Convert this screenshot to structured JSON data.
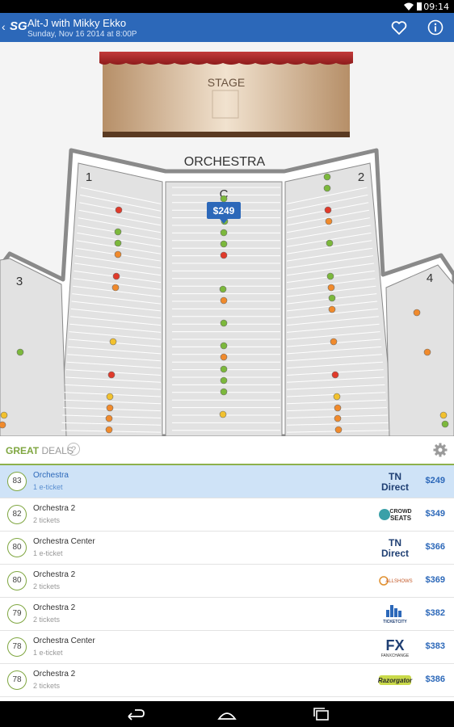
{
  "status_bar": {
    "time": "09:14"
  },
  "header": {
    "logo_text": "SG",
    "title": "Alt-J with Mikky Ekko",
    "subtitle": "Sunday, Nov 16 2014 at 8:00P"
  },
  "seat_map": {
    "stage_label": "STAGE",
    "orchestra_label": "ORCHESTRA",
    "section_numbers": [
      "1",
      "2",
      "3",
      "4"
    ],
    "center_section_label": "C",
    "price_tooltip": "$249"
  },
  "deals": {
    "title_great": "GREAT",
    "title_deals": " DEALS",
    "help_icon": "?",
    "rows": [
      {
        "score": "83",
        "section": "Orchestra",
        "tickets": "1 e-ticket",
        "vendor": "TN Direct",
        "vendor_line1": "TN",
        "vendor_line2": "Direct",
        "price": "$249",
        "selected": true
      },
      {
        "score": "82",
        "section": "Orchestra 2",
        "tickets": "2 tickets",
        "vendor": "CrowdSeats",
        "vendor_line1": "CROWD",
        "vendor_line2": "SEATS",
        "price": "$349"
      },
      {
        "score": "80",
        "section": "Orchestra Center",
        "tickets": "1 e-ticket",
        "vendor": "TN Direct",
        "vendor_line1": "TN",
        "vendor_line2": "Direct",
        "price": "$366"
      },
      {
        "score": "80",
        "section": "Orchestra 2",
        "tickets": "2 tickets",
        "vendor": "AllShows",
        "vendor_line1": "ALLSHOWS",
        "vendor_line2": "",
        "price": "$369"
      },
      {
        "score": "79",
        "section": "Orchestra 2",
        "tickets": "2 tickets",
        "vendor": "TicketCity",
        "vendor_line1": "TICKETCITY",
        "vendor_line2": "",
        "price": "$382"
      },
      {
        "score": "78",
        "section": "Orchestra Center",
        "tickets": "1 e-ticket",
        "vendor": "FanXchange",
        "vendor_line1": "FX",
        "vendor_line2": "FANXCHANGE",
        "price": "$383"
      },
      {
        "score": "78",
        "section": "Orchestra 2",
        "tickets": "2 tickets",
        "vendor": "RazorGator",
        "vendor_line1": "Razorgator",
        "vendor_line2": "",
        "price": "$386"
      }
    ]
  },
  "colors": {
    "brand": "#2c68b9",
    "accent_green": "#7fa640",
    "selected_row": "#cfe3f7"
  },
  "icons": [
    "back-icon",
    "heart-icon",
    "info-icon",
    "help-icon",
    "gear-icon",
    "nav-back-icon",
    "nav-home-icon",
    "nav-recents-icon"
  ]
}
